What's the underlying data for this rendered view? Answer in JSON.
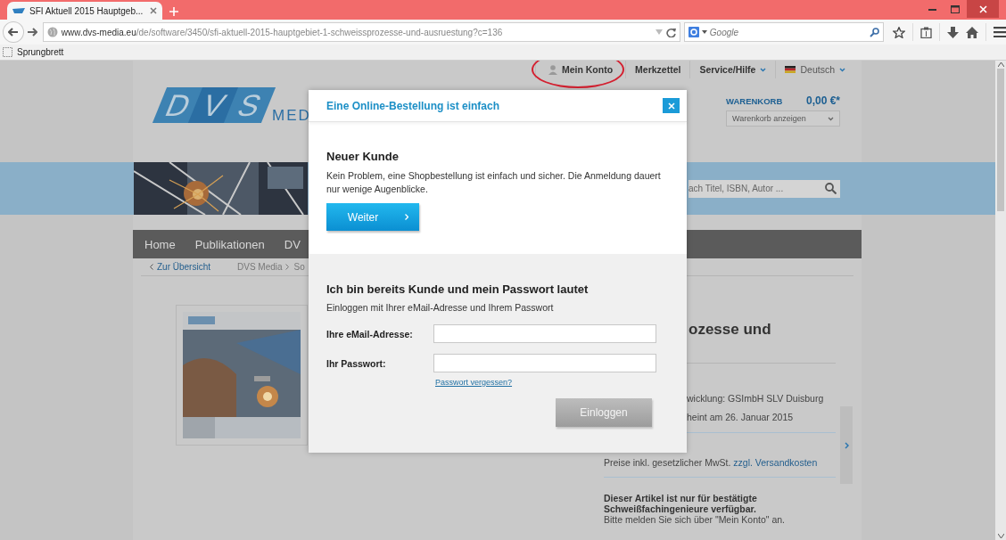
{
  "browser": {
    "tab": {
      "title": "SFI Aktuell 2015 Hauptgeb..."
    },
    "url": {
      "host": "www.dvs-media.eu",
      "path": "/de/software/3450/sfi-aktuell-2015-hauptgebiet-1-schweissprozesse-und-ausruestung?c=136"
    },
    "search": {
      "placeholder": "Google"
    },
    "bookmarks": [
      {
        "label": "Sprungbrett"
      }
    ]
  },
  "page": {
    "top_links": [
      {
        "label": "Mein Konto",
        "kind": "account",
        "circled": true
      },
      {
        "label": "Merkzettel",
        "kind": "plain",
        "circled": false
      },
      {
        "label": "Service/Hilfe",
        "kind": "menu",
        "circled": false
      },
      {
        "label": "Deutsch",
        "kind": "language",
        "circled": false
      }
    ],
    "logo": {
      "letters": [
        "D",
        "V",
        "S"
      ],
      "suffix": "MED"
    },
    "cart": {
      "label": "WARENKORB",
      "total": "0,00 €*",
      "dropdown": "Warenkorb anzeigen"
    },
    "search": {
      "placeholder": "ach Titel, ISBN, Autor ..."
    },
    "nav": [
      {
        "label": "Home"
      },
      {
        "label": "Publikationen"
      },
      {
        "label": "DV"
      }
    ],
    "breadcrumb": [
      {
        "label": "Zur Übersicht",
        "kind": "back"
      },
      {
        "label": "DVS Media",
        "kind": "crumb"
      },
      {
        "label": "So",
        "kind": "crumb"
      }
    ],
    "product": {
      "title": "ozesse und",
      "details": [
        "wicklung: GSImbH SLV Duisburg",
        "heint am 26. Januar 2015"
      ],
      "price_note": "Preise inkl. gesetzlicher MwSt.",
      "shipping_link": "zzgl. Versandkosten",
      "notice_bold": "Dieser Artikel ist nur für bestätigte Schweißfachingenieure verfügbar.",
      "notice": "Bitte melden Sie sich über \"Mein Konto\" an."
    }
  },
  "modal": {
    "title": "Eine Online-Bestellung ist einfach",
    "new_customer": {
      "heading": "Neuer Kunde",
      "text": "Kein Problem, eine Shopbestellung ist einfach und sicher. Die Anmeldung dauert nur wenige Augenblicke.",
      "button": "Weiter"
    },
    "login": {
      "heading": "Ich bin bereits Kunde und mein Passwort lautet",
      "text": "Einloggen mit Ihrer eMail-Adresse und Ihrem Passwort",
      "fields": [
        {
          "label": "Ihre eMail-Adresse:"
        },
        {
          "label": "Ihr Passwort:"
        }
      ],
      "forgot_link": "Passwort vergessen?",
      "button": "Einloggen"
    }
  }
}
